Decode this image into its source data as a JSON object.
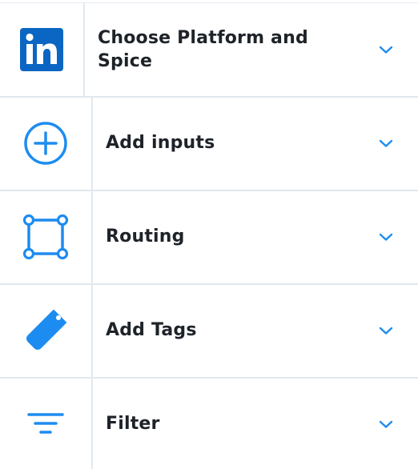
{
  "colors": {
    "accent": "#1d8cf0",
    "linkedin": "#0a66c2",
    "text": "#1e2329",
    "divider": "#e1e8ef"
  },
  "steps": [
    {
      "label": "Choose Platform and Spice",
      "icon": "linkedin-icon"
    },
    {
      "label": "Add inputs",
      "icon": "plus-circle-icon"
    },
    {
      "label": "Routing",
      "icon": "routing-square-icon"
    },
    {
      "label": "Add Tags",
      "icon": "tag-icon"
    },
    {
      "label": "Filter",
      "icon": "filter-icon"
    }
  ]
}
